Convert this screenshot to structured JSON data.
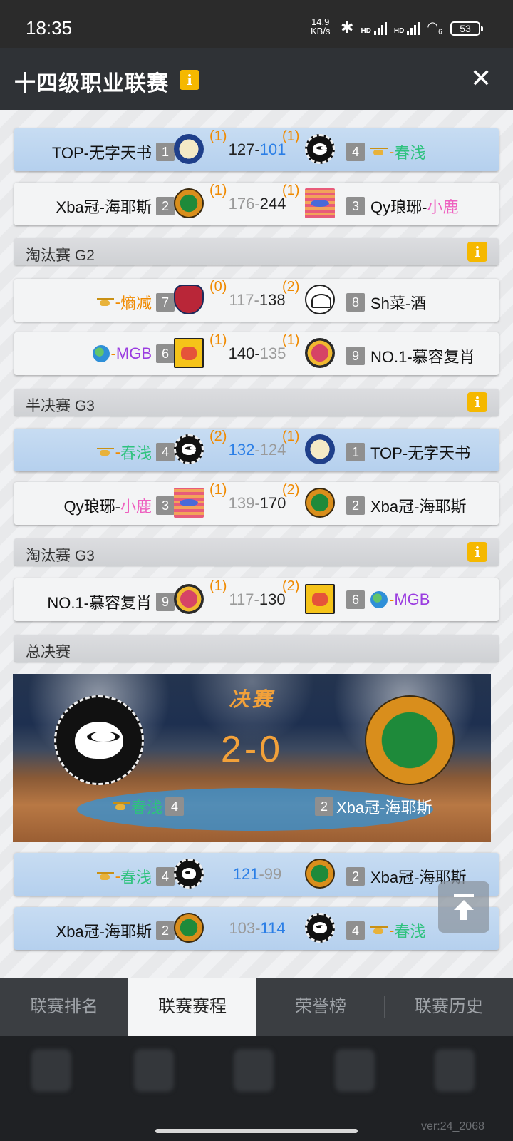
{
  "status_bar": {
    "time": "18:35",
    "net_speed_value": "14.9",
    "net_speed_unit": "KB/s",
    "battery": "53",
    "signal_label": "HD",
    "wifi_sub": "6"
  },
  "header": {
    "title": "十四级职业联赛",
    "info": "i",
    "close": "✕"
  },
  "matches": [
    {
      "left_name": "TOP-无字天书",
      "left_rank": "1",
      "left_count": "(1)",
      "left_score": "127",
      "right_score": "101",
      "right_count": "(1)",
      "right_rank": "4",
      "right_prefix": "-",
      "right_name": "春浅"
    },
    {
      "left_name": "Xba冠-海耶斯",
      "left_rank": "2",
      "left_count": "(1)",
      "left_score": "176",
      "right_score": "244",
      "right_count": "(1)",
      "right_rank": "3",
      "right_prefix": "Qy琅琊-",
      "right_name": "小鹿"
    },
    {
      "left_prefix": "-",
      "left_name": "熵减",
      "left_rank": "7",
      "left_count": "(0)",
      "left_score": "117",
      "right_score": "138",
      "right_count": "(2)",
      "right_rank": "8",
      "right_name": "Sh菜-酒"
    },
    {
      "left_prefix": "-",
      "left_name": "MGB",
      "left_rank": "6",
      "left_count": "(1)",
      "left_score": "140",
      "right_score": "135",
      "right_count": "(1)",
      "right_rank": "9",
      "right_name": "NO.1-慕容复肖"
    },
    {
      "left_prefix": "-",
      "left_name": "春浅",
      "left_rank": "4",
      "left_count": "(2)",
      "left_score": "132",
      "right_score": "124",
      "right_count": "(1)",
      "right_rank": "1",
      "right_name": "TOP-无字天书"
    },
    {
      "left_prefix": "Qy琅琊-",
      "left_name": "小鹿",
      "left_rank": "3",
      "left_count": "(1)",
      "left_score": "139",
      "right_score": "170",
      "right_count": "(2)",
      "right_rank": "2",
      "right_name": "Xba冠-海耶斯"
    },
    {
      "left_name": "NO.1-慕容复肖",
      "left_rank": "9",
      "left_count": "(1)",
      "left_score": "117",
      "right_score": "130",
      "right_count": "(2)",
      "right_rank": "6",
      "right_prefix": "-",
      "right_name": "MGB"
    },
    {
      "left_prefix": "-",
      "left_name": "春浅",
      "left_rank": "4",
      "left_score": "121",
      "right_score": "99",
      "right_rank": "2",
      "right_name": "Xba冠-海耶斯"
    },
    {
      "left_name": "Xba冠-海耶斯",
      "left_rank": "2",
      "left_score": "103",
      "right_score": "114",
      "right_rank": "4",
      "right_prefix": "-",
      "right_name": "春浅"
    }
  ],
  "sections": {
    "elim_g2": "淘汰赛 G2",
    "semi_g3": "半决赛 G3",
    "elim_g3": "淘汰赛 G3",
    "final": "总决赛"
  },
  "final_banner": {
    "title": "决赛",
    "score": "2-0",
    "left_name": "春浅",
    "left_rank": "4",
    "right_rank": "2",
    "right_name": "Xba冠-海耶斯"
  },
  "score_dash": "-",
  "tabs": [
    "联赛排名",
    "联赛赛程",
    "荣誉榜",
    "联赛历史"
  ],
  "version": "ver:24_2068",
  "colors": {
    "accent_orange": "#f08a00",
    "win_blue": "#2a7ee6",
    "name_green": "#2ec27e",
    "name_pink": "#ee5fbf",
    "name_purple": "#9a3ce0",
    "info_yellow": "#f5b800"
  }
}
